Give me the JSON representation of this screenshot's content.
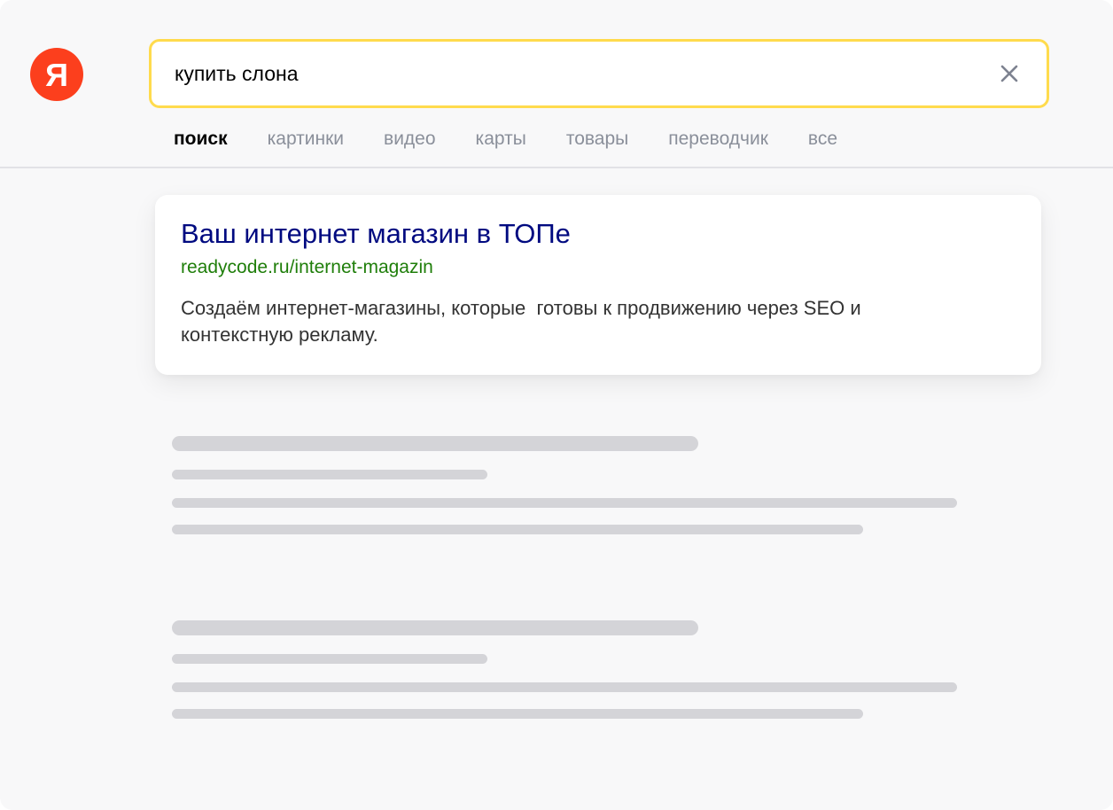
{
  "logo": {
    "letter": "Я"
  },
  "search": {
    "query": "купить слона"
  },
  "tabs": [
    {
      "label": "поиск",
      "active": true
    },
    {
      "label": "картинки",
      "active": false
    },
    {
      "label": "видео",
      "active": false
    },
    {
      "label": "карты",
      "active": false
    },
    {
      "label": "товары",
      "active": false
    },
    {
      "label": "переводчик",
      "active": false
    },
    {
      "label": "все",
      "active": false
    }
  ],
  "result": {
    "title": "Ваш интернет магазин в ТОПе",
    "url": "readycode.ru/internet-magazin",
    "snippet": "Создаём интернет-магазины, которые  готовы к продвижению через SEO и\nконтекстную рекламу."
  },
  "colors": {
    "brand": "#fc3f1d",
    "search_border": "#ffdb4d",
    "title_link": "#000a80",
    "url": "#1f7e0a",
    "skeleton": "#d4d4d8"
  },
  "icons": {
    "clear": "close-icon"
  }
}
